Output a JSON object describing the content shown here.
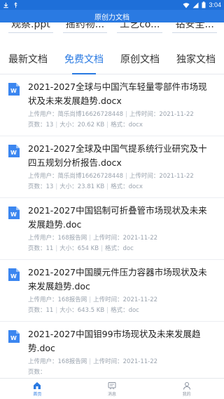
{
  "status_bar": {
    "time": "3:04"
  },
  "app_header": {
    "title": "原创力文档"
  },
  "categories": [
    "观察.ppt",
    "摇药物...",
    "工艺co...",
    "钻安全..."
  ],
  "tabs": [
    {
      "label": "最新文档",
      "active": false
    },
    {
      "label": "免费文档",
      "active": true
    },
    {
      "label": "原创文档",
      "active": false
    },
    {
      "label": "独家文档",
      "active": false
    }
  ],
  "documents": [
    {
      "title": "2021-2027全球与中国汽车轻量零部件市场现状及未来发展趋势.docx",
      "uploader_label": "上传用户：",
      "uploader": "简乐尚博16626728448",
      "time_label": "上传时间：",
      "time": "2021-11-22",
      "pages_label": "页数：",
      "pages": "13",
      "size_label": "大小：",
      "size": "20.62 KB",
      "format_label": "格式：",
      "format": "docx"
    },
    {
      "title": "2021-2027全球及中国气提系统行业研究及十四五规划分析报告.docx",
      "uploader_label": "上传用户：",
      "uploader": "简乐尚博16626728448",
      "time_label": "上传时间：",
      "time": "2021-11-22",
      "pages_label": "页数：",
      "pages": "13",
      "size_label": "大小：",
      "size": "23.81 KB",
      "format_label": "格式：",
      "format": "docx"
    },
    {
      "title": "2021-2027中国铝制可折叠管市场现状及未来发展趋势.doc",
      "uploader_label": "上传用户：",
      "uploader": "168报告网",
      "time_label": "上传时间：",
      "time": "2021-11-22",
      "pages_label": "页数：",
      "pages": "11",
      "size_label": "大小：",
      "size": "654 KB",
      "format_label": "格式：",
      "format": "doc"
    },
    {
      "title": "2021-2027中国膜元件压力容器市场现状及未来发展趋势.doc",
      "uploader_label": "上传用户：",
      "uploader": "168报告网",
      "time_label": "上传时间：",
      "time": "2021-11-22",
      "pages_label": "页数：",
      "pages": "11",
      "size_label": "大小：",
      "size": "643.5 KB",
      "format_label": "格式：",
      "format": "doc"
    },
    {
      "title": "2021-2027中国钼99市场现状及未来发展趋势.doc",
      "uploader_label": "上传用户：",
      "uploader": "168报告网",
      "time_label": "上传时间：",
      "time": "2021-11-22",
      "pages_label": "页数：",
      "pages": "",
      "size_label": "",
      "size": "",
      "format_label": "",
      "format": ""
    }
  ],
  "bottom_nav": [
    {
      "label": "首页",
      "icon": "home-icon",
      "active": true
    },
    {
      "label": "消息",
      "icon": "message-icon",
      "active": false
    },
    {
      "label": "我的",
      "icon": "profile-icon",
      "active": false
    }
  ],
  "colors": {
    "accent": "#2a7ae2",
    "status_bar": "#1e6fd9",
    "meta_text": "#9aa3ae"
  }
}
